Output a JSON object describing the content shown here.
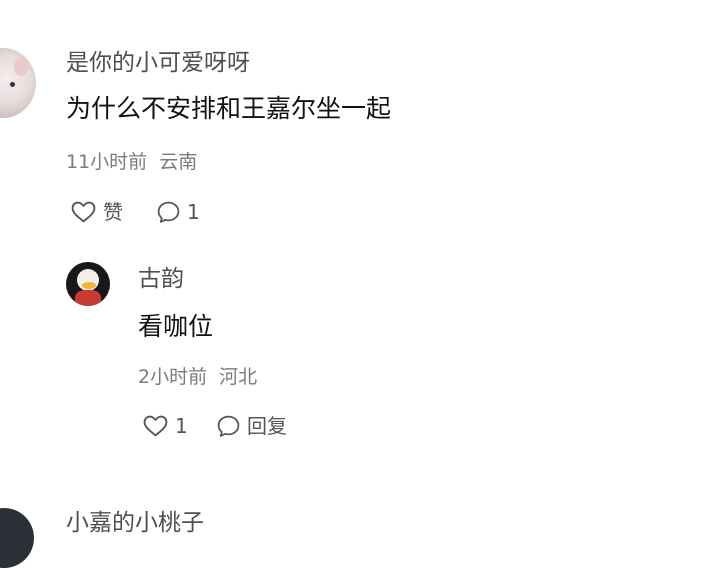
{
  "comments": [
    {
      "username": "是你的小可爱呀呀",
      "content": "为什么不安排和王嘉尔坐一起",
      "time": "11小时前",
      "location": "云南",
      "like_label": "赞",
      "reply_count": "1",
      "reply": {
        "username": "古韵",
        "content": "看咖位",
        "time": "2小时前",
        "location": "河北",
        "like_count": "1",
        "reply_label": "回复"
      }
    },
    {
      "username": "小嘉的小桃子"
    }
  ],
  "icons": {
    "like": "heart-outline-icon",
    "comment": "speech-bubble-icon"
  },
  "colors": {
    "background": "#ffffff",
    "username": "#4f4f4f",
    "content": "#111111",
    "meta": "#7c7c7c",
    "icon": "#555555"
  }
}
